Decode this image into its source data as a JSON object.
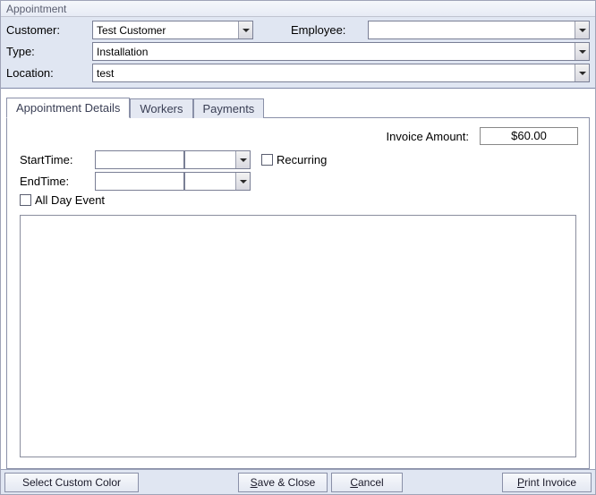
{
  "window": {
    "title": "Appointment"
  },
  "header": {
    "customer_label": "Customer:",
    "customer_value": "Test Customer",
    "employee_label": "Employee:",
    "employee_value": "",
    "type_label": "Type:",
    "type_value": "Installation",
    "location_label": "Location:",
    "location_value": "test"
  },
  "tabs": {
    "details": "Appointment Details",
    "workers": "Workers",
    "payments": "Payments"
  },
  "details": {
    "invoice_label": "Invoice Amount:",
    "invoice_value": "$60.00",
    "start_label": "StartTime:",
    "start_value": "",
    "start_time_value": "",
    "end_label": "EndTime:",
    "end_value": "",
    "end_time_value": "",
    "recurring_label": "Recurring",
    "alldayevent_label": "All Day Event",
    "notes_value": ""
  },
  "footer": {
    "select_color": "Select Custom Color",
    "save_close_pre": "S",
    "save_close_rest": "ave & Close",
    "cancel_pre": "C",
    "cancel_rest": "ancel",
    "print_pre": "P",
    "print_rest": "rint Invoice"
  }
}
